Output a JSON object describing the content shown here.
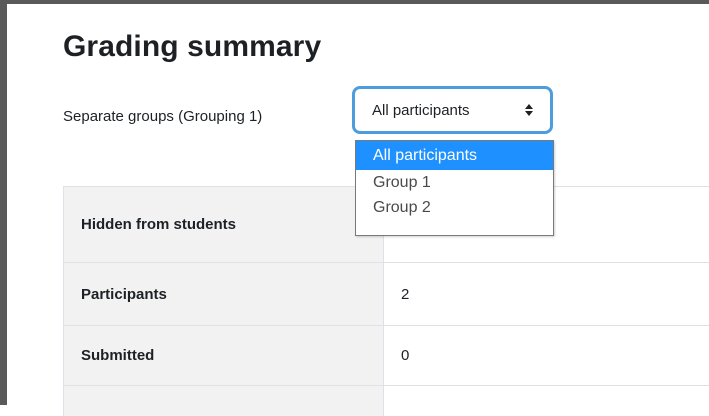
{
  "page": {
    "title": "Grading summary"
  },
  "group_filter": {
    "label": "Separate groups (Grouping 1)",
    "selected": "All participants",
    "options": [
      "All participants",
      "Group 1",
      "Group 2"
    ]
  },
  "summary_table": {
    "rows": [
      {
        "label": "Hidden from students",
        "value": ""
      },
      {
        "label": "Participants",
        "value": "2"
      },
      {
        "label": "Submitted",
        "value": "0"
      },
      {
        "label": "",
        "value": ""
      }
    ]
  },
  "colors": {
    "select_focus_border": "#4d9dde",
    "option_highlight": "#1e90ff",
    "table_label_background": "#f2f2f2",
    "window_border": "#5a5a5a"
  },
  "icons": {
    "select_caret": "sort-caret-icon"
  }
}
